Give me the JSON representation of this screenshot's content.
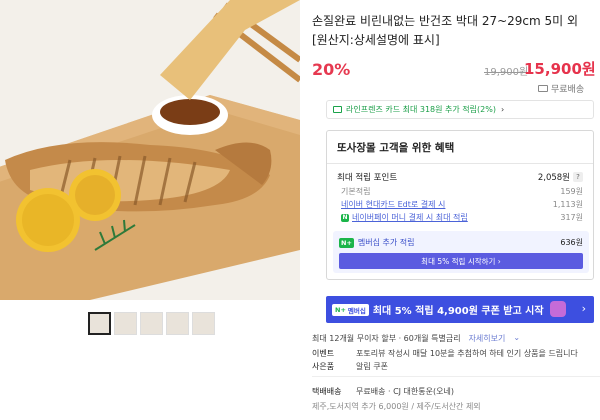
{
  "product": {
    "title": "손질완료 비린내없는 반건조 박대 27~29cm 5미 외 [원산지:상세설명에 표시]",
    "discount": "20%",
    "original_price": "19,900원",
    "sale_price": "15,900원",
    "shipping": "무료배송"
  },
  "card_promo": {
    "prefix": "라인프렌즈 카드 최대 318원 추가 적립(2%)",
    "arrow": "›"
  },
  "benefits": {
    "title": "또사장몰 고객을 위한 혜택",
    "max_points_label": "최대 적립 포인트",
    "max_points_value": "2,058원",
    "help": "?",
    "rows": [
      {
        "label": "기본적립",
        "value": "159원"
      },
      {
        "label": "네이버 현대카드 Edt로 결제 시",
        "value": "1,113원"
      },
      {
        "label": "네이버페이 머니 결제 시 최대 적립",
        "value": "317원"
      }
    ],
    "member_badge": "N+",
    "member_label": "멤버십 추가 적립",
    "member_value": "636원",
    "member_button": "최대 5% 적립 시작하기 ›"
  },
  "banner": {
    "badge_n": "N+",
    "badge_text": "멤버십",
    "text": "최대 5% 적립 4,900원 쿠폰 받고 시작",
    "arrow": "›"
  },
  "details": [
    {
      "key": "최대 12개월 무이자 할부 · 60개월 특별금리",
      "value": "자세히보기",
      "extra": "⌄"
    },
    {
      "key": "이벤트",
      "value": "포토리뷰 작성시 매달 10분을 추첨하여 하테 인기 상품을 드립니다"
    },
    {
      "key": "사은품",
      "value": "알림 쿠폰"
    },
    {
      "key": "택배배송",
      "value": "무료배송 · CJ 대한통운(오네)"
    },
    {
      "key": "",
      "value": "제주,도서지역 추가 6,000원 / 제주/도서산간 제외"
    }
  ]
}
